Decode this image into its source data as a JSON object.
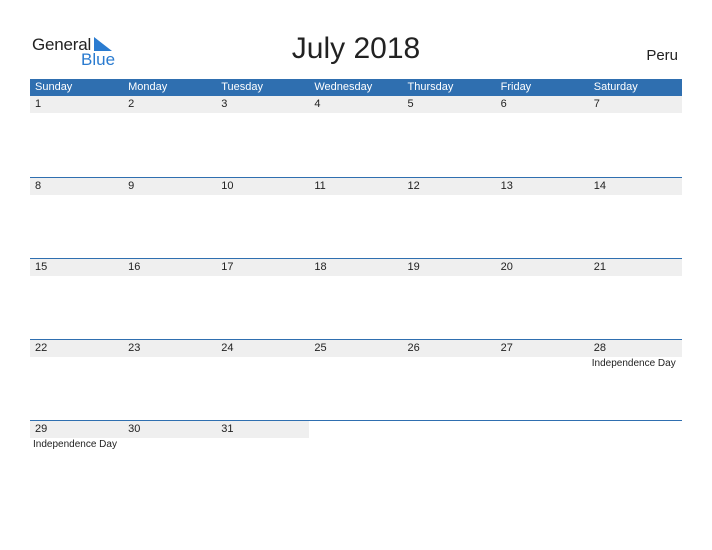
{
  "logo": {
    "part1": "General",
    "part2": "Blue"
  },
  "title": "July 2018",
  "country": "Peru",
  "colors": {
    "header_bg": "#2f6fb0",
    "date_band": "#efefef",
    "brand_blue": "#2a7bd0"
  },
  "weekdays": [
    "Sunday",
    "Monday",
    "Tuesday",
    "Wednesday",
    "Thursday",
    "Friday",
    "Saturday"
  ],
  "weeks": [
    {
      "days": [
        "1",
        "2",
        "3",
        "4",
        "5",
        "6",
        "7"
      ],
      "events": [
        "",
        "",
        "",
        "",
        "",
        "",
        ""
      ]
    },
    {
      "days": [
        "8",
        "9",
        "10",
        "11",
        "12",
        "13",
        "14"
      ],
      "events": [
        "",
        "",
        "",
        "",
        "",
        "",
        ""
      ]
    },
    {
      "days": [
        "15",
        "16",
        "17",
        "18",
        "19",
        "20",
        "21"
      ],
      "events": [
        "",
        "",
        "",
        "",
        "",
        "",
        ""
      ]
    },
    {
      "days": [
        "22",
        "23",
        "24",
        "25",
        "26",
        "27",
        "28"
      ],
      "events": [
        "",
        "",
        "",
        "",
        "",
        "",
        "Independence Day"
      ]
    },
    {
      "days": [
        "29",
        "30",
        "31",
        "",
        "",
        "",
        ""
      ],
      "events": [
        "Independence Day",
        "",
        "",
        "",
        "",
        "",
        ""
      ]
    }
  ]
}
